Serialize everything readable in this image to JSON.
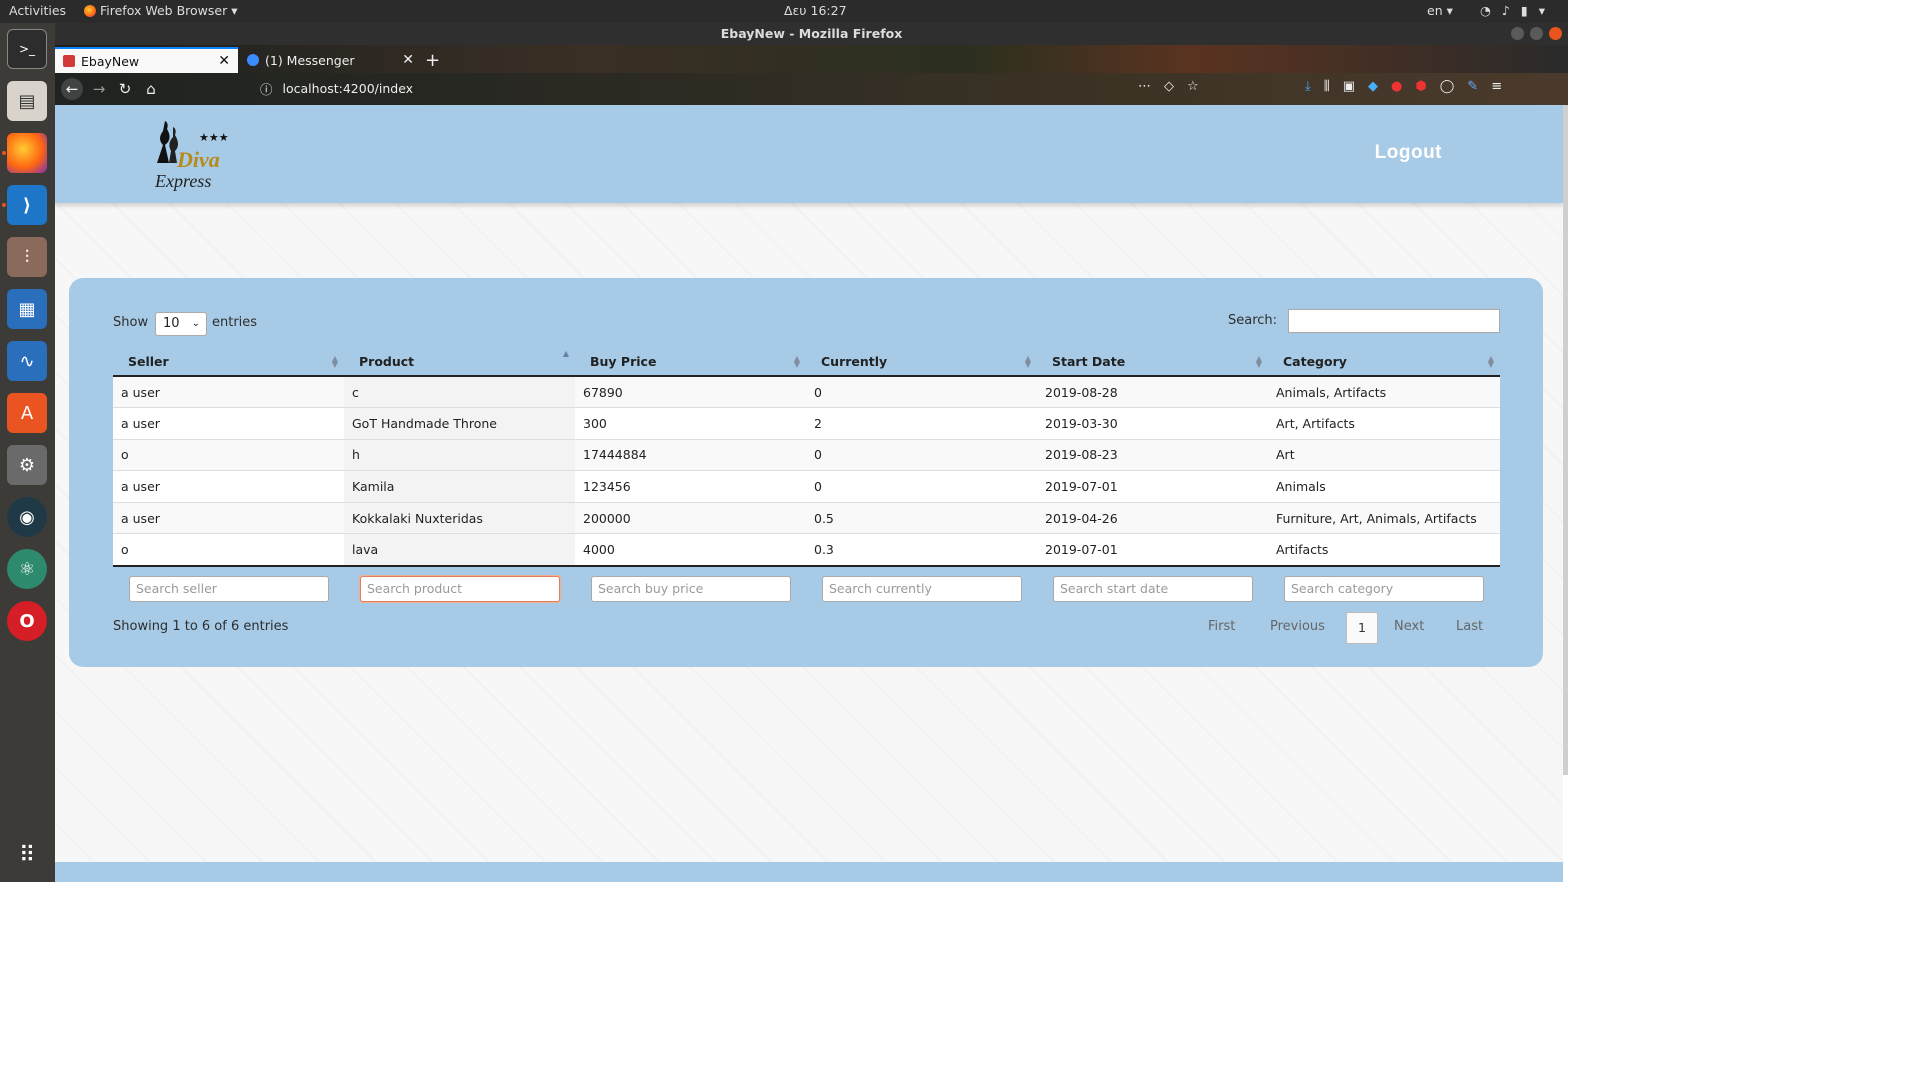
{
  "os": {
    "activities": "Activities",
    "app_menu": "Firefox Web Browser",
    "clock": "Δευ 16:27",
    "lang": "en"
  },
  "window": {
    "title": "EbayNew - Mozilla Firefox"
  },
  "tabs": [
    {
      "label": "EbayNew",
      "close": "✕"
    },
    {
      "label": "(1) Messenger",
      "close": "✕"
    }
  ],
  "new_tab": "+",
  "url": "localhost:4200/index",
  "site": {
    "logo_text": "Diva Express",
    "logout": "Logout"
  },
  "table_controls": {
    "show": "Show",
    "entries_value": "10",
    "entries": "entries",
    "search_label": "Search:"
  },
  "table": {
    "columns": [
      "Seller",
      "Product",
      "Buy Price",
      "Currently",
      "Start Date",
      "Category"
    ],
    "sorted_column": "Product",
    "rows": [
      [
        "a user",
        "c",
        "67890",
        "0",
        "2019-08-28",
        "Animals, Artifacts"
      ],
      [
        "a user",
        "GoT Handmade Throne",
        "300",
        "2",
        "2019-03-30",
        "Art, Artifacts"
      ],
      [
        "o",
        "h",
        "17444884",
        "0",
        "2019-08-23",
        "Art"
      ],
      [
        "a user",
        "Kamila",
        "123456",
        "0",
        "2019-07-01",
        "Animals"
      ],
      [
        "a user",
        "Kokkalaki Nuxteridas",
        "200000",
        "0.5",
        "2019-04-26",
        "Furniture, Art, Animals, Artifacts"
      ],
      [
        "o",
        "lava",
        "4000",
        "0.3",
        "2019-07-01",
        "Artifacts"
      ]
    ]
  },
  "column_search": {
    "seller": "Search seller",
    "product": "Search product",
    "buy_price": "Search buy price",
    "currently": "Search currently",
    "start_date": "Search start date",
    "category": "Search category"
  },
  "info": "Showing 1 to 6 of 6 entries",
  "pagination": {
    "first": "First",
    "previous": "Previous",
    "current": "1",
    "next": "Next",
    "last": "Last"
  },
  "colors": {
    "header_blue": "#a7cbe6",
    "accent": "#e95420"
  }
}
